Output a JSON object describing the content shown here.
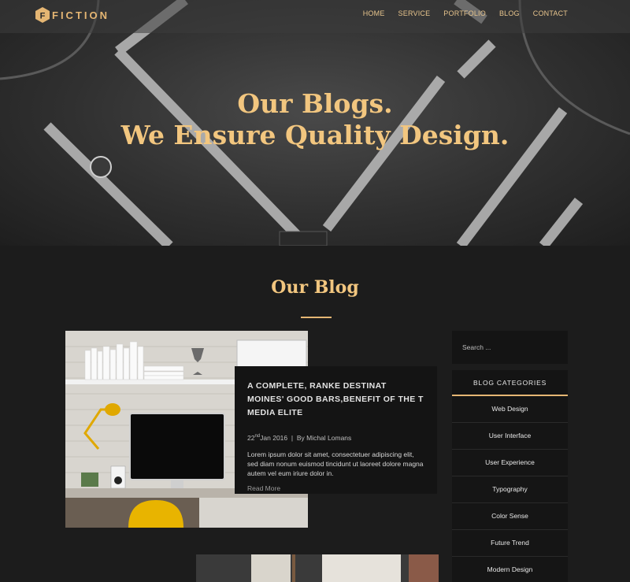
{
  "brand": {
    "name": "FICTION",
    "mark": "F",
    "accent": "#e5b673"
  },
  "nav": {
    "items": [
      "HOME",
      "SERVICE",
      "PORTFOLIO",
      "BLOG",
      "CONTACT"
    ]
  },
  "hero": {
    "line1": "Our Blogs.",
    "line2": "We Ensure Quality Design."
  },
  "section": {
    "title": "Our Blog"
  },
  "post": {
    "title": "A COMPLETE, RANKE DESTINAT MOINES' GOOD BARS,BENEFIT OF THE T MEDIA ELITE",
    "day": "22",
    "day_suffix": "nd",
    "date_rest": "Jan 2016",
    "separator": "|",
    "author": "By Michal Lomans",
    "excerpt": "Lorem ipsum dolor sit amet, consectetuer adipiscing elit, sed diam nonum euismod tincidunt ut laoreet dolore magna autem vel eum iriure dolor in.",
    "read_more": "Read More"
  },
  "sidebar": {
    "search_placeholder": "Search ...",
    "categories_title": "BLOG CATEGORIES",
    "categories": [
      "Web Design",
      "User Interface",
      "User Experience",
      "Typography",
      "Color Sense",
      "Future Trend",
      "Modern Design"
    ]
  },
  "icons": {
    "logo": "hexagon-logo-icon"
  }
}
